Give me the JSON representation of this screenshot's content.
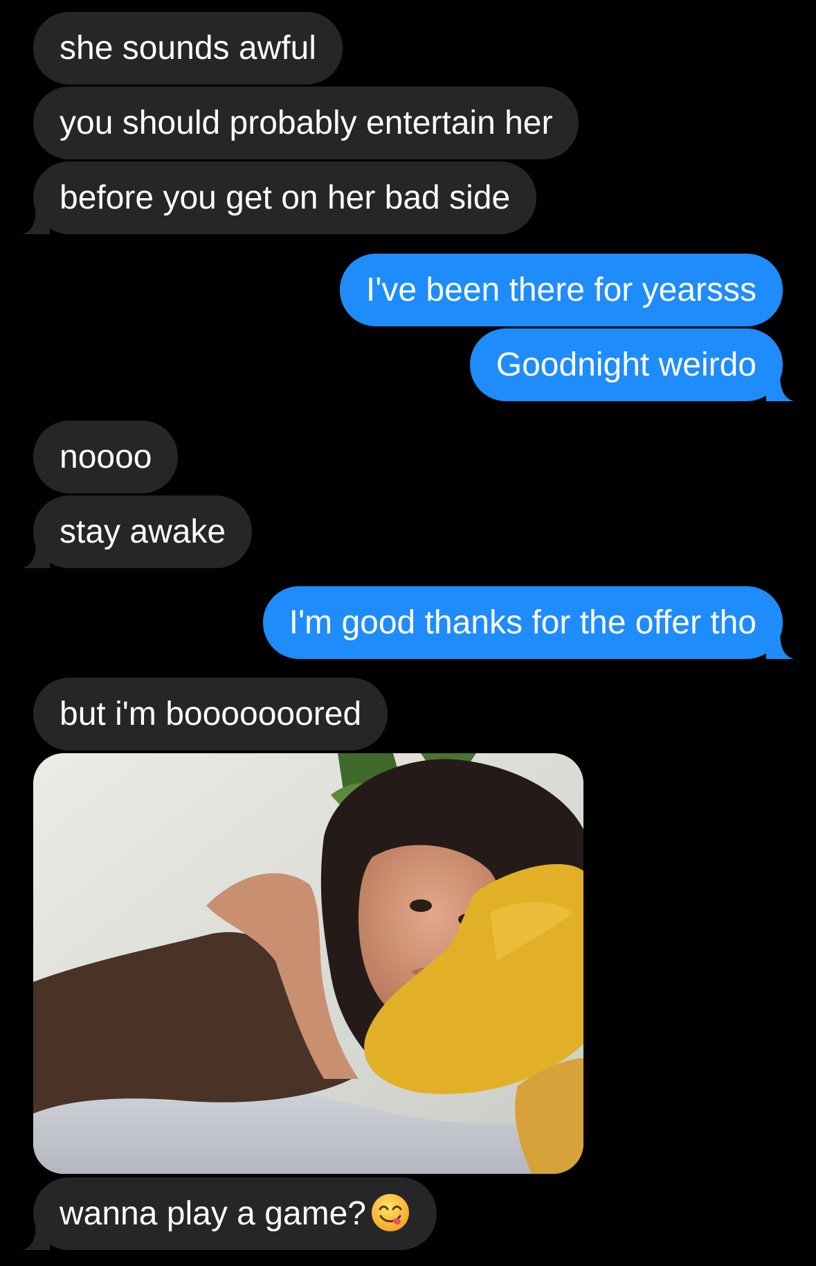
{
  "messages": [
    {
      "side": "received",
      "text": "she sounds awful"
    },
    {
      "side": "received",
      "text": "you should probably entertain her"
    },
    {
      "side": "received",
      "text": "before you get on her bad side"
    },
    {
      "side": "sent",
      "text": "I've been there for yearsss"
    },
    {
      "side": "sent",
      "text": "Goodnight weirdo"
    },
    {
      "side": "received",
      "text": "noooo"
    },
    {
      "side": "received",
      "text": "stay awake"
    },
    {
      "side": "sent",
      "text": "I'm good thanks for the offer tho"
    },
    {
      "side": "received",
      "text": "but i'm booooooored"
    },
    {
      "side": "received",
      "text": "wanna play a game?",
      "emoji": "face-savoring-food-emoji"
    }
  ],
  "colors": {
    "background": "#000000",
    "received_bubble": "#262628",
    "sent_bubble": "#1e8cfb",
    "text": "#ffffff"
  },
  "attachments": [
    {
      "type": "photo",
      "description_icon": "selfie-photo"
    }
  ]
}
